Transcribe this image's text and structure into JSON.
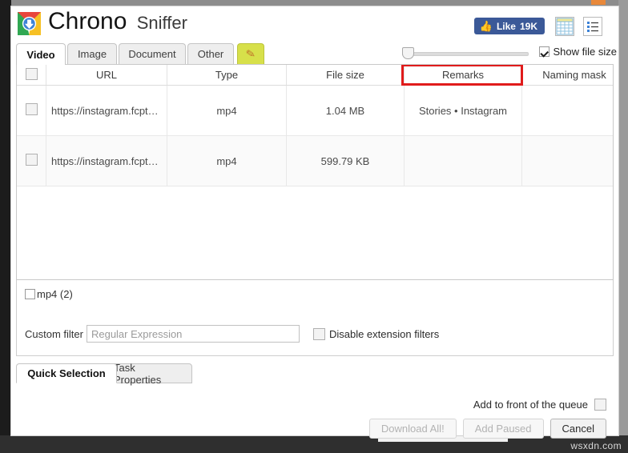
{
  "window": {
    "title_bold": "Chrono",
    "title_light": "Sniffer",
    "logo_icon": "chrono-download-logo"
  },
  "header": {
    "like_button": {
      "icon": "thumbs-up-icon",
      "label": "Like",
      "count": "19K"
    },
    "grid_view_icon": "grid-view-icon",
    "list_view_icon": "list-view-icon"
  },
  "tabs": [
    {
      "label": "Video",
      "active": true
    },
    {
      "label": "Image",
      "active": false
    },
    {
      "label": "Document",
      "active": false
    },
    {
      "label": "Other",
      "active": false
    },
    {
      "label": "",
      "icon": "pencil-icon",
      "active": false
    }
  ],
  "toolbar": {
    "thumb_size_slider": {
      "icon": "slider-handle",
      "value": 0
    },
    "show_file_size": {
      "label": "Show file size",
      "checked": true
    }
  },
  "table": {
    "select_all": {
      "checked": false
    },
    "columns": [
      "",
      "URL",
      "Type",
      "File size",
      "Remarks",
      "Naming mask"
    ],
    "highlight_column": "Remarks",
    "highlight_color": "#e01b1b",
    "rows": [
      {
        "selected": false,
        "url": "https://instagram.fcpt7-...",
        "type": "mp4",
        "file_size": "1.04 MB",
        "remarks": "Stories • Instagram",
        "naming_mask": ""
      },
      {
        "selected": false,
        "url": "https://instagram.fcpt7-...",
        "type": "mp4",
        "file_size": "599.79 KB",
        "remarks": "",
        "naming_mask": ""
      }
    ]
  },
  "quick_selection": {
    "extension_groups": [
      {
        "label": "mp4 (2)",
        "checked": false
      }
    ],
    "custom_filter": {
      "label": "Custom filter",
      "value": "",
      "placeholder": "Regular Expression"
    },
    "disable_extension_filters": {
      "label": "Disable extension filters",
      "checked": false
    }
  },
  "bottom_tabs": [
    {
      "label": "Quick Selection",
      "active": true
    },
    {
      "label": "Task Properties",
      "active": false
    }
  ],
  "footer": {
    "add_to_front": {
      "label": "Add to front of the queue",
      "checked": false
    },
    "buttons": [
      {
        "label": "Download All!",
        "disabled": true
      },
      {
        "label": "Add Paused",
        "disabled": true
      },
      {
        "label": "Cancel",
        "disabled": false
      }
    ]
  },
  "overlay": {
    "watermark": "wsxdn.com",
    "partial_logo_text": "wsxdn.com"
  }
}
